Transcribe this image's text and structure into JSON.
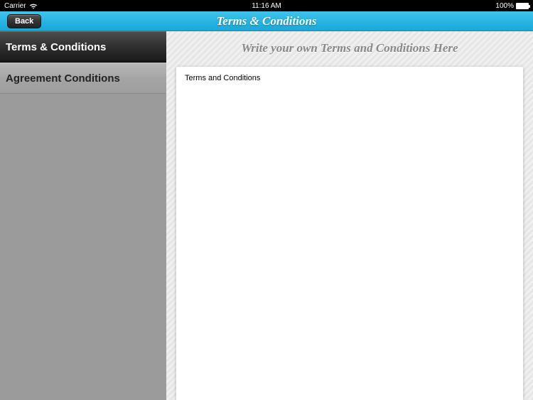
{
  "statusBar": {
    "carrier": "Carrier",
    "time": "11:16 AM",
    "battery": "100%"
  },
  "navBar": {
    "backLabel": "Back",
    "title": "Terms & Conditions"
  },
  "sidebar": {
    "items": [
      {
        "label": "Terms & Conditions"
      },
      {
        "label": "Agreement Conditions"
      }
    ]
  },
  "content": {
    "headerText": "Write your own Terms and Conditions Here",
    "cardText": "Terms and Conditions"
  }
}
